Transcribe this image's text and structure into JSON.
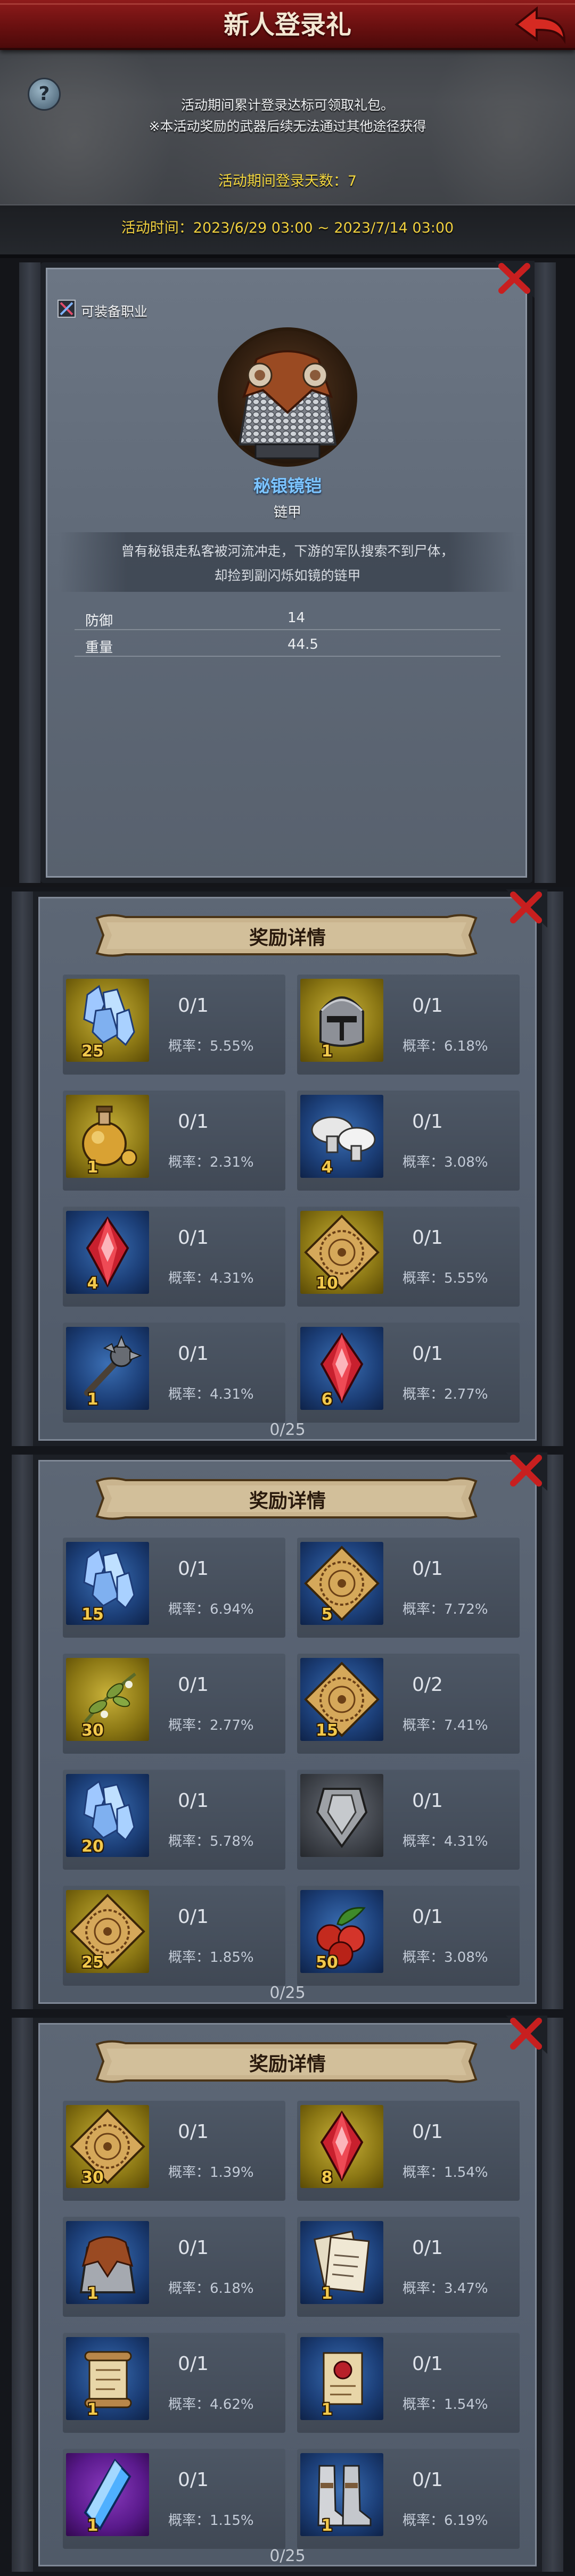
{
  "header": {
    "title": "新人登录礼",
    "help_label": "?",
    "desc_line1": "活动期间累计登录达标可领取礼包。",
    "desc_line2": "※本活动奖励的武器后续无法通过其他途径获得",
    "login_days": "活动期间登录天数：7",
    "activity_time": "活动时间：2023/6/29 03:00 ~ 2023/7/14 03:00"
  },
  "item_detail": {
    "equip_class_label": "可装备职业",
    "name": "秘银镜铠",
    "type": "链甲",
    "description_line1": "曾有秘银走私客被河流冲走，下游的军队搜索不到尸体，",
    "description_line2": "却捡到副闪烁如镜的链甲",
    "stats": [
      {
        "name": "防御",
        "value": "14"
      },
      {
        "name": "重量",
        "value": "44.5"
      }
    ]
  },
  "reward_panels": [
    {
      "title": "奖励详情",
      "total": "0/25",
      "items": [
        {
          "icon": "crystal-icon",
          "count": "25",
          "progress": "0/1",
          "prob": "概率：5.55%",
          "rarity": "yellow"
        },
        {
          "icon": "helmet-icon",
          "count": "1",
          "progress": "0/1",
          "prob": "概率：6.18%",
          "rarity": "yellow"
        },
        {
          "icon": "potion-icon",
          "count": "1",
          "progress": "0/1",
          "prob": "概率：2.31%",
          "rarity": "yellow"
        },
        {
          "icon": "mushroom-icon",
          "count": "4",
          "progress": "0/1",
          "prob": "概率：3.08%",
          "rarity": "blue"
        },
        {
          "icon": "red-gem-icon",
          "count": "4",
          "progress": "0/1",
          "prob": "概率：4.31%",
          "rarity": "blue"
        },
        {
          "icon": "rune-tile-icon",
          "count": "10",
          "progress": "0/1",
          "prob": "概率：5.55%",
          "rarity": "yellow"
        },
        {
          "icon": "mace-icon",
          "count": "1",
          "progress": "0/1",
          "prob": "概率：4.31%",
          "rarity": "blue"
        },
        {
          "icon": "red-gem-icon",
          "count": "6",
          "progress": "0/1",
          "prob": "概率：2.77%",
          "rarity": "blue"
        }
      ]
    },
    {
      "title": "奖励详情",
      "total": "0/25",
      "items": [
        {
          "icon": "crystal-icon",
          "count": "15",
          "progress": "0/1",
          "prob": "概率：6.94%",
          "rarity": "blue"
        },
        {
          "icon": "rune-tile-icon",
          "count": "5",
          "progress": "0/1",
          "prob": "概率：7.72%",
          "rarity": "blue"
        },
        {
          "icon": "herb-icon",
          "count": "30",
          "progress": "0/1",
          "prob": "概率：2.77%",
          "rarity": "yellow"
        },
        {
          "icon": "rune-tile-icon",
          "count": "15",
          "progress": "0/2",
          "prob": "概率：7.41%",
          "rarity": "blue"
        },
        {
          "icon": "crystal-icon",
          "count": "20",
          "progress": "0/1",
          "prob": "概率：5.78%",
          "rarity": "blue"
        },
        {
          "icon": "armor-plate-icon",
          "count": "",
          "progress": "0/1",
          "prob": "概率：4.31%",
          "rarity": "gray"
        },
        {
          "icon": "rune-tile-icon",
          "count": "25",
          "progress": "0/1",
          "prob": "概率：1.85%",
          "rarity": "yellow"
        },
        {
          "icon": "berries-icon",
          "count": "50",
          "progress": "0/1",
          "prob": "概率：3.08%",
          "rarity": "blue"
        }
      ]
    },
    {
      "title": "奖励详情",
      "total": "0/25",
      "items": [
        {
          "icon": "rune-tile-icon",
          "count": "30",
          "progress": "0/1",
          "prob": "概率：1.39%",
          "rarity": "yellow"
        },
        {
          "icon": "red-gem-icon",
          "count": "8",
          "progress": "0/1",
          "prob": "概率：1.54%",
          "rarity": "yellow"
        },
        {
          "icon": "chainmail-icon",
          "count": "1",
          "progress": "0/1",
          "prob": "概率：6.18%",
          "rarity": "blue"
        },
        {
          "icon": "letter-icon",
          "count": "1",
          "progress": "0/1",
          "prob": "概率：3.47%",
          "rarity": "blue"
        },
        {
          "icon": "scroll-icon",
          "count": "1",
          "progress": "0/1",
          "prob": "概率：4.62%",
          "rarity": "blue"
        },
        {
          "icon": "sealed-scroll-icon",
          "count": "1",
          "progress": "0/1",
          "prob": "概率：1.54%",
          "rarity": "blue"
        },
        {
          "icon": "blue-crystal-icon",
          "count": "1",
          "progress": "0/1",
          "prob": "概率：1.15%",
          "rarity": "purple"
        },
        {
          "icon": "boots-icon",
          "count": "1",
          "progress": "0/1",
          "prob": "概率：6.19%",
          "rarity": "blue"
        }
      ]
    }
  ],
  "colors": {
    "title_bar": "#8e1b1b",
    "highlight_yellow": "#f2d640",
    "item_name_blue": "#7cc4ff",
    "count_gold": "#f2c94c"
  }
}
